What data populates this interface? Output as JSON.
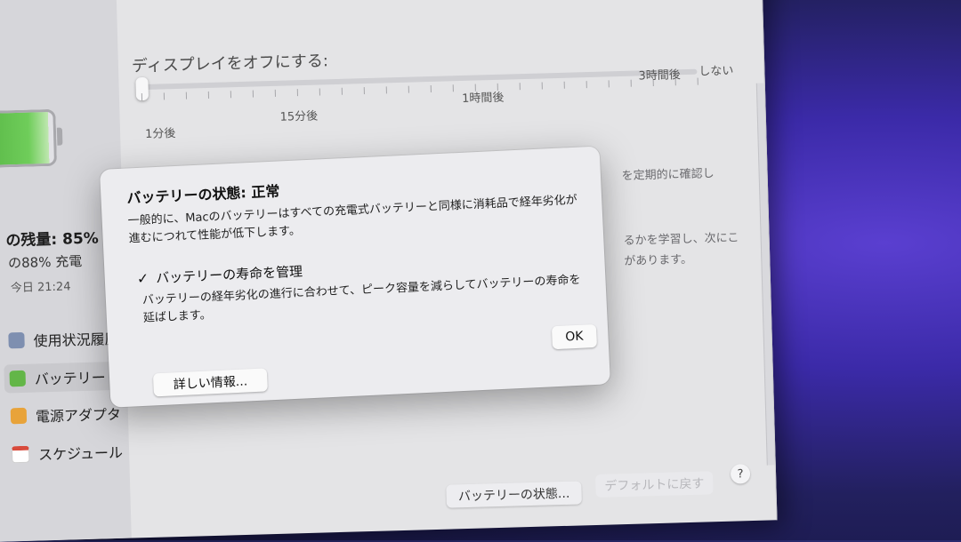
{
  "sidebar": {
    "battery_level": "の残量: 85%",
    "battery_capacity": "の88% 充電",
    "last_charged": "今日 21:24",
    "items": [
      {
        "label": "使用状況履歴"
      },
      {
        "label": "バッテリー"
      },
      {
        "label": "電源アダプタ"
      },
      {
        "label": "スケジュール"
      }
    ]
  },
  "display_sleep": {
    "label": "ディスプレイをオフにする:",
    "tick_labels": [
      "1分後",
      "15分後",
      "1時間後",
      "3時間後",
      "しない"
    ],
    "value": "1分後"
  },
  "background_text": {
    "line1": "を定期的に確認し",
    "line2": "るかを学習し、次にこ",
    "line3": "があります。"
  },
  "dialog": {
    "title": "バッテリーの状態: 正常",
    "description": "一般的に、Macのバッテリーはすべての充電式バッテリーと同様に消耗品で経年劣化が進むにつれて性能が低下します。",
    "checkbox_label": "バッテリーの寿命を管理",
    "checkbox_checked": true,
    "checkmark": "✓",
    "checkbox_description": "バッテリーの経年劣化の進行に合わせて、ピーク容量を減らしてバッテリーの寿命を延ばします。",
    "ok_label": "OK",
    "details_label": "詳しい情報..."
  },
  "footer": {
    "battery_status_label": "バッテリーの状態...",
    "default_label": "デフォルトに戻す",
    "help_label": "?"
  }
}
